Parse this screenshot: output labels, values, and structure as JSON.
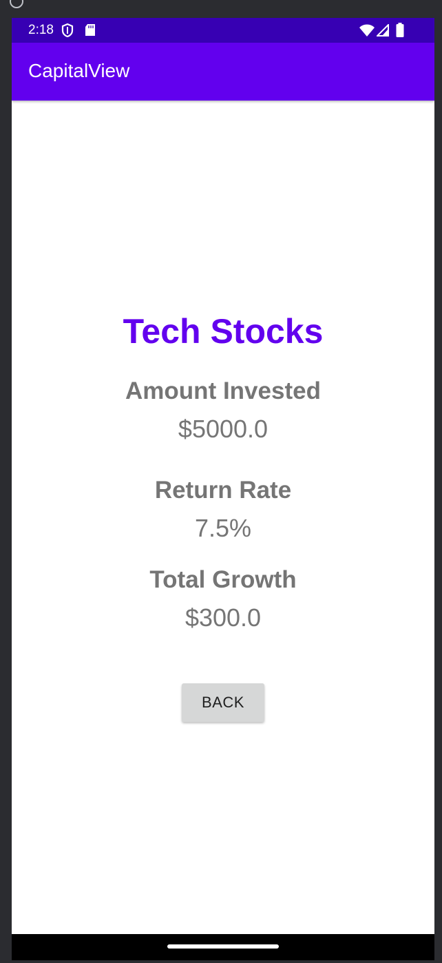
{
  "status_bar": {
    "time": "2:18"
  },
  "app_bar": {
    "title": "CapitalView"
  },
  "investment": {
    "title": "Tech Stocks",
    "amount_label": "Amount Invested",
    "amount_value": "$5000.0",
    "rate_label": "Return Rate",
    "rate_value": "7.5%",
    "growth_label": "Total Growth",
    "growth_value": "$300.0"
  },
  "actions": {
    "back_label": "BACK"
  },
  "colors": {
    "status_bar": "#3700b3",
    "app_bar": "#6200ee",
    "heading": "#6200ee",
    "text_gray": "#757575",
    "button_bg": "#d6d7d7"
  },
  "icons": [
    "shield-icon",
    "sd-card-icon",
    "wifi-icon",
    "signal-icon",
    "battery-icon"
  ]
}
